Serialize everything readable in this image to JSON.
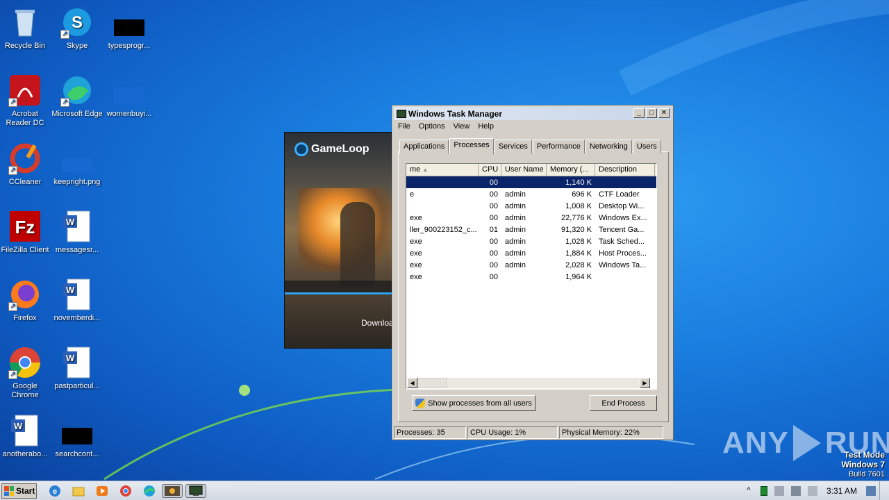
{
  "desktop": {
    "icons": [
      {
        "label": "Recycle Bin",
        "icon": "recycle-bin-icon"
      },
      {
        "label": "Skype",
        "icon": "skype-icon"
      },
      {
        "label": "typesprogr...",
        "icon": "black-file-icon"
      },
      {
        "label": "Acrobat Reader DC",
        "icon": "acrobat-icon"
      },
      {
        "label": "Microsoft Edge",
        "icon": "edge-icon"
      },
      {
        "label": "womenbuyi...",
        "icon": "blue-file-icon"
      },
      {
        "label": "CCleaner",
        "icon": "ccleaner-icon"
      },
      {
        "label": "keepright.png",
        "icon": "blue-image-icon"
      },
      {
        "label": "FileZilla Client",
        "icon": "filezilla-icon"
      },
      {
        "label": "messagesr...",
        "icon": "word-doc-icon"
      },
      {
        "label": "Firefox",
        "icon": "firefox-icon"
      },
      {
        "label": "novemberdi...",
        "icon": "word-doc-icon"
      },
      {
        "label": "Google Chrome",
        "icon": "chrome-icon"
      },
      {
        "label": "pastparticul...",
        "icon": "word-doc-icon"
      },
      {
        "label": "anotherabo...",
        "icon": "word-doc-icon"
      },
      {
        "label": "searchcont...",
        "icon": "black-file-icon"
      }
    ]
  },
  "gameloop": {
    "brand": "GameLoop",
    "download_text": "Downloa"
  },
  "task_manager": {
    "title": "Windows Task Manager",
    "window_buttons": {
      "minimize": "_",
      "maximize": "□",
      "close": "✕"
    },
    "menu": [
      "File",
      "Options",
      "View",
      "Help"
    ],
    "tabs": [
      "Applications",
      "Processes",
      "Services",
      "Performance",
      "Networking",
      "Users"
    ],
    "active_tab": "Processes",
    "columns": [
      "me",
      "CPU",
      "User Name",
      "Memory (...",
      "Description"
    ],
    "sort_indicator": "▲",
    "rows": [
      {
        "name": "",
        "cpu": "00",
        "user": "",
        "mem": "1,140 K",
        "desc": "",
        "selected": true
      },
      {
        "name": "e",
        "cpu": "00",
        "user": "admin",
        "mem": "696 K",
        "desc": "CTF Loader"
      },
      {
        "name": "",
        "cpu": "00",
        "user": "admin",
        "mem": "1,008 K",
        "desc": "Desktop Wi..."
      },
      {
        "name": "exe",
        "cpu": "00",
        "user": "admin",
        "mem": "22,776 K",
        "desc": "Windows Ex..."
      },
      {
        "name": "ller_900223152_c...",
        "cpu": "01",
        "user": "admin",
        "mem": "91,320 K",
        "desc": "Tencent Ga..."
      },
      {
        "name": "exe",
        "cpu": "00",
        "user": "admin",
        "mem": "1,028 K",
        "desc": "Task Sched..."
      },
      {
        "name": "exe",
        "cpu": "00",
        "user": "admin",
        "mem": "1,884 K",
        "desc": "Host Proces..."
      },
      {
        "name": "exe",
        "cpu": "00",
        "user": "admin",
        "mem": "2,028 K",
        "desc": "Windows Ta..."
      },
      {
        "name": "exe",
        "cpu": "00",
        "user": "",
        "mem": "1,964 K",
        "desc": ""
      }
    ],
    "show_all_button": "Show processes from all users",
    "end_process_button": "End Process",
    "status": {
      "processes": "Processes: 35",
      "cpu": "CPU Usage: 1%",
      "memory": "Physical Memory: 22%"
    }
  },
  "watermark": {
    "brand_left": "ANY",
    "brand_right": "RUN",
    "mode": "Test Mode",
    "os": "Windows 7",
    "build": "Build 7601"
  },
  "taskbar": {
    "start_label": "Start",
    "apps": [
      "ie-icon",
      "explorer-icon",
      "media-player-icon",
      "chrome-icon",
      "edge-icon",
      "gameloop-icon",
      "task-manager-icon"
    ],
    "clock": "3:31 AM"
  }
}
